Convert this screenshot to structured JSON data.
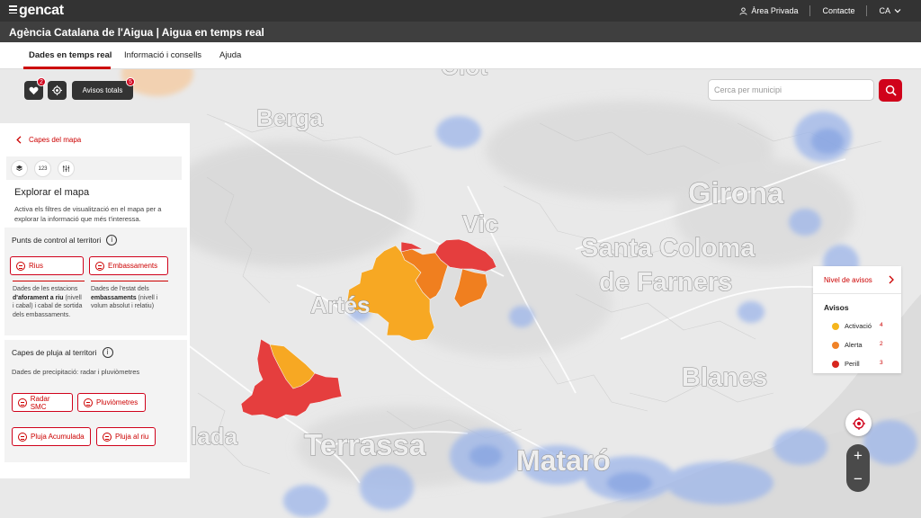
{
  "header": {
    "logo": "gencat",
    "links": {
      "private_area": "Àrea Privada",
      "contact": "Contacte",
      "language": "CA"
    }
  },
  "title": "Agència Catalana de l'Aigua | Aigua en temps real",
  "tabs": [
    {
      "label": "Dades en temps real",
      "active": true
    },
    {
      "label": "Informació i consells",
      "active": false
    },
    {
      "label": "Ajuda",
      "active": false
    }
  ],
  "toolbar": {
    "favorites_badge": "2",
    "avisos_label": "Avisos totals",
    "avisos_badge": "5"
  },
  "search": {
    "placeholder": "Cerca per municipi"
  },
  "panel": {
    "back_label": "Capes del mapa",
    "mode_numbers": "123",
    "heading": "Explorar el mapa",
    "intro": "Activa els filtres de visualització en el mapa per a explorar la informació que més t'interessa.",
    "control": {
      "title": "Punts de control al territori",
      "rius": "Rius",
      "embassaments": "Embassaments",
      "rius_desc": {
        "pre": "Dades de les estacions ",
        "bold": "d'aforament a riu",
        "post": " (nivell i cabal) i cabal de sortida dels embassaments."
      },
      "emb_desc": {
        "pre": "Dades de l'estat dels ",
        "bold": "embassaments",
        "post": " (nivell i volum absolut i relatiu)"
      }
    },
    "pluja": {
      "title": "Capes de pluja al territori",
      "subtitle": "Dades de precipitació: radar i pluviòmetres",
      "radar": "Radar SMC",
      "pluviometres": "Pluviòmetres",
      "acumulada": "Pluja Acumulada",
      "riu": "Pluja al riu"
    }
  },
  "map_labels": {
    "berga": "Berga",
    "girona": "Girona",
    "vic": "Vic",
    "santa_coloma_1": "Santa Coloma",
    "santa_coloma_2": "de Farners",
    "artes": "Artés",
    "blanes": "Blanes",
    "ilada": "lada",
    "terrassa": "Terrassa",
    "mataro": "Mataró",
    "olot": "Olot"
  },
  "legend": {
    "title": "Nivel de avisos",
    "avisos": "Avisos",
    "items": [
      {
        "label": "Activació",
        "count": "4",
        "color": "#f5b51c"
      },
      {
        "label": "Alerta",
        "count": "2",
        "color": "#f08227"
      },
      {
        "label": "Perill",
        "count": "3",
        "color": "#d7261e"
      }
    ]
  },
  "zoom": {
    "in": "+",
    "out": "−"
  },
  "colors": {
    "accent": "#d0021b",
    "warning_activacio": "#f7a823",
    "warning_alerta": "#f07f1f",
    "warning_perill": "#e53e3e"
  }
}
